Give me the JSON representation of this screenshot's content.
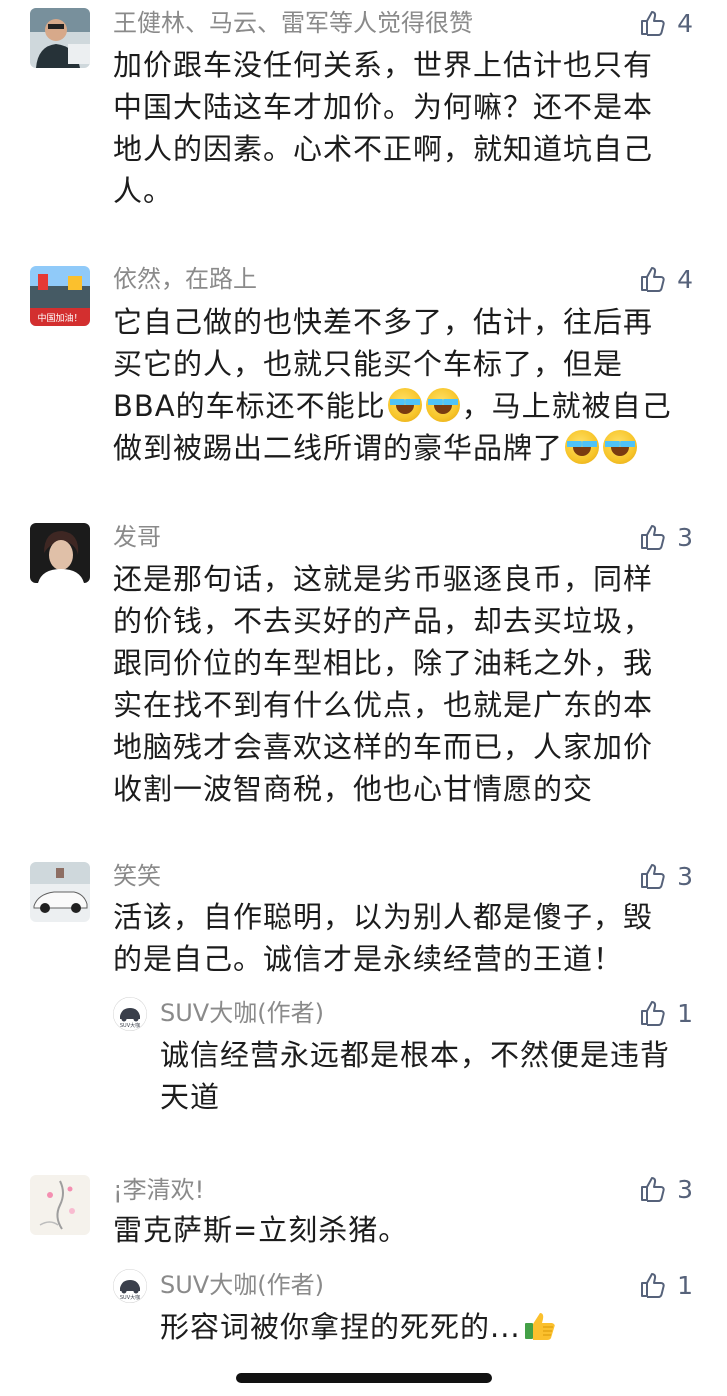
{
  "comments": [
    {
      "name": "王健林、马云、雷军等人觉得很赞",
      "likes": "4",
      "lines": [
        "加价跟车没任何关系，世界上估计也只有",
        "中国大陆这车才加价。为何嘛？还不是本",
        "地人的因素。心术不正啊，就知道坑自己",
        "人。"
      ]
    },
    {
      "name": "依然，在路上",
      "likes": "4",
      "avatar_text": "中国加油！",
      "line1": "它自己做的也快差不多了，估计，往后再",
      "line2": "买它的人，也就只能买个车标了，但是",
      "line3": "BBA的车标还不能比",
      "line3b": "，马上就被自己",
      "line4": "做到被踢出二线所谓的豪华品牌了"
    },
    {
      "name": "发哥",
      "likes": "3",
      "lines": [
        "还是那句话，这就是劣币驱逐良币，同样",
        "的价钱，不去买好的产品，却去买垃圾，",
        "跟同价位的车型相比，除了油耗之外，我",
        "实在找不到有什么优点，也就是广东的本",
        "地脑残才会喜欢这样的车而已，人家加价",
        "收割一波智商税，他也心甘情愿的交"
      ]
    },
    {
      "name": "笑笑",
      "likes": "3",
      "lines": [
        "活该，自作聪明，以为别人都是傻子，毁",
        "的是自己。诚信才是永续经营的王道！"
      ],
      "reply": {
        "name": "SUV大咖(作者)",
        "avatar_text": "SUV大咖",
        "likes": "1",
        "lines": [
          "诚信经营永远都是根本，不然便是违背",
          "天道"
        ]
      }
    },
    {
      "name": "¡李清欢!",
      "likes": "3",
      "lines": [
        "雷克萨斯=立刻杀猪。"
      ],
      "reply": {
        "name": "SUV大咖(作者)",
        "avatar_text": "SUV大咖",
        "likes": "1",
        "text": "形容词被你拿捏的死死的..."
      }
    }
  ],
  "icons": {
    "like": "thumbs-up-outline-icon",
    "laugh_cry_emoji": "face-with-tears-of-joy",
    "thumbs_up_emoji": "thumbs-up-emoji"
  },
  "colors": {
    "like_icon": "#56627a",
    "name": "#8a8a8a",
    "text": "#1c1c1c"
  }
}
